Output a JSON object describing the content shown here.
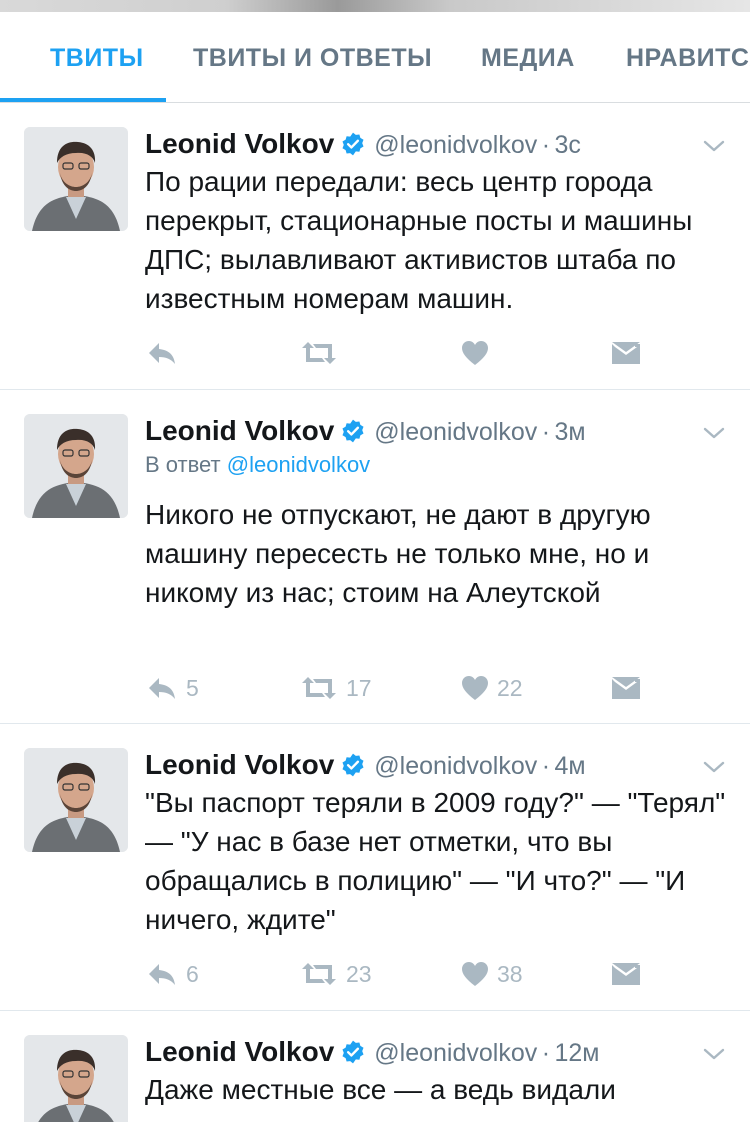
{
  "tabs": [
    {
      "label": "ТВИТЫ",
      "active": true
    },
    {
      "label": "ТВИТЫ И ОТВЕТЫ",
      "active": false
    },
    {
      "label": "МЕДИА",
      "active": false
    },
    {
      "label": "НРАВИТСЯ",
      "active": false
    }
  ],
  "colors": {
    "accent": "#1da1f2",
    "muted": "#657786",
    "icon": "#aab8c2"
  },
  "icons": {
    "verified": "verified-badge-icon",
    "caret": "chevron-down-icon",
    "reply": "reply-icon",
    "retweet": "retweet-icon",
    "like": "heart-icon",
    "dm": "direct-message-icon"
  },
  "tweets": [
    {
      "name": "Leonid Volkov",
      "handle": "@leonidvolkov",
      "separator": "·",
      "time": "3с",
      "reply_to_prefix": "",
      "reply_to_handle": "",
      "text": "По рации передали: весь центр города перекрыт, стационарные посты и машины ДПС; вылавливают активистов штаба по известным номерам машин.",
      "counts": {
        "reply": "",
        "retweet": "",
        "like": ""
      }
    },
    {
      "name": "Leonid Volkov",
      "handle": "@leonidvolkov",
      "separator": "·",
      "time": "3м",
      "reply_to_prefix": "В ответ",
      "reply_to_handle": "@leonidvolkov",
      "text": "Никого не отпускают, не дают в другую машину пересесть не только мне, но и никому из нас; стоим на Алеутской",
      "counts": {
        "reply": "5",
        "retweet": "17",
        "like": "22"
      }
    },
    {
      "name": "Leonid Volkov",
      "handle": "@leonidvolkov",
      "separator": "·",
      "time": "4м",
      "reply_to_prefix": "",
      "reply_to_handle": "",
      "text": "\"Вы паспорт теряли в 2009 году?\" — \"Терял\" — \"У нас в базе нет отметки, что вы обращались в полицию\" — \"И что?\" — \"И ничего, ждите\"",
      "counts": {
        "reply": "6",
        "retweet": "23",
        "like": "38"
      }
    },
    {
      "name": "Leonid Volkov",
      "handle": "@leonidvolkov",
      "separator": "·",
      "time": "12м",
      "reply_to_prefix": "",
      "reply_to_handle": "",
      "text": "Даже местные все — а ведь видали",
      "counts": {
        "reply": "",
        "retweet": "",
        "like": ""
      }
    }
  ]
}
